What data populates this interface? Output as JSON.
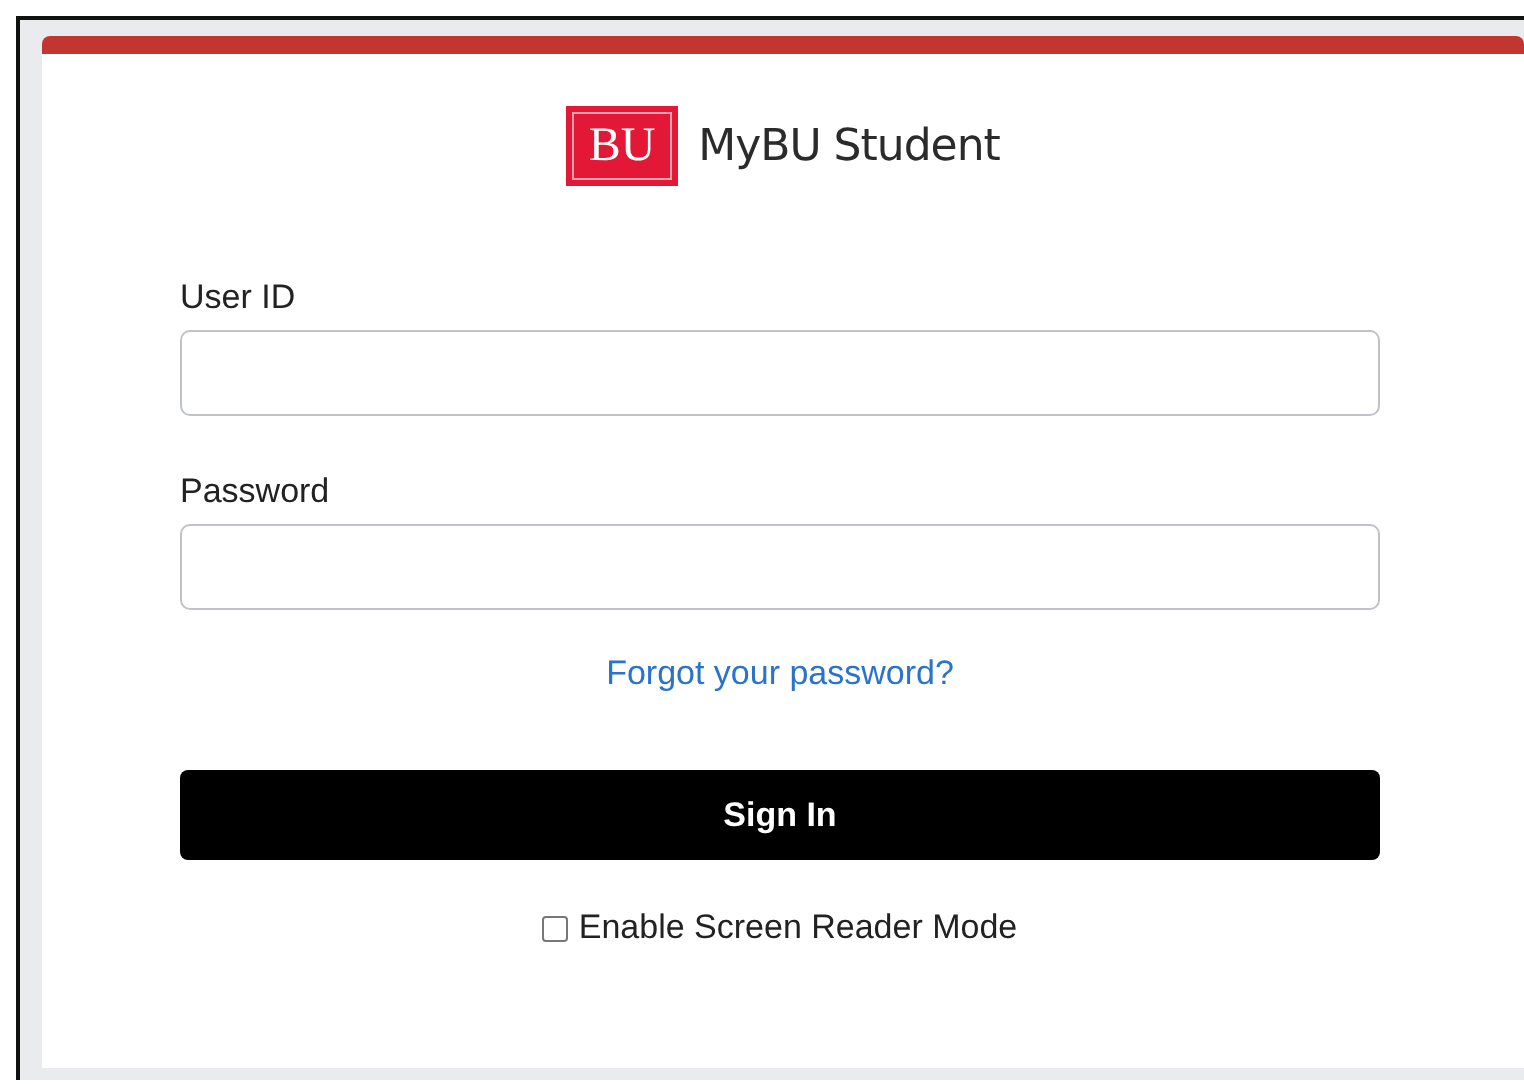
{
  "logo": {
    "mark": "BU",
    "title": "MyBU Student"
  },
  "fields": [
    {
      "label": "User ID"
    },
    {
      "label": "Password"
    }
  ],
  "forgot_link": "Forgot your password?",
  "sign_in_button": "Sign In",
  "screen_reader": {
    "label": "Enable Screen Reader Mode",
    "checked": false
  }
}
